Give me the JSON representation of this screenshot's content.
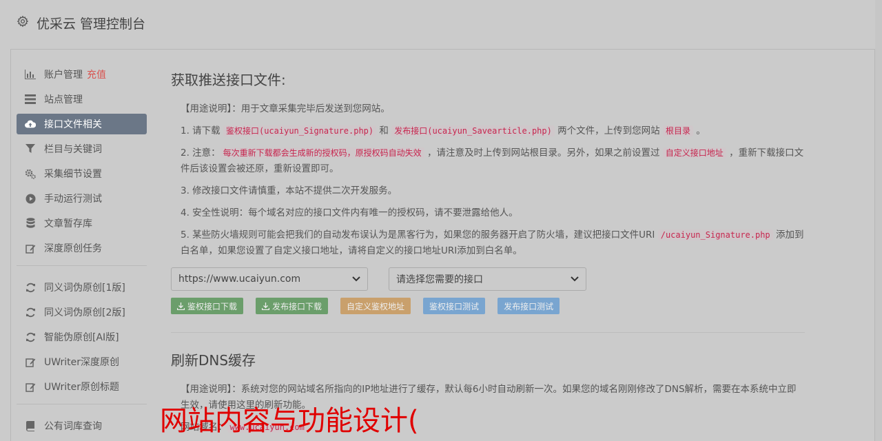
{
  "header": {
    "title": "优采云 管理控制台",
    "icon": "gear-icon"
  },
  "sidebar": {
    "items": [
      {
        "label": "账户管理",
        "extra": "充值",
        "icon": "bar-chart-icon"
      },
      {
        "label": "站点管理",
        "icon": "server-icon"
      },
      {
        "label": "接口文件相关",
        "icon": "cloud-upload-icon",
        "active": true
      },
      {
        "label": "栏目与关键词",
        "icon": "filter-icon"
      },
      {
        "label": "采集细节设置",
        "icon": "cogs-icon"
      },
      {
        "label": "手动运行测试",
        "icon": "play-circle-icon"
      },
      {
        "label": "文章暂存库",
        "icon": "database-icon"
      },
      {
        "label": "深度原创任务",
        "icon": "edit-icon"
      }
    ],
    "items2": [
      {
        "label": "同义词伪原创[1版]",
        "icon": "refresh-icon"
      },
      {
        "label": "同义词伪原创[2版]",
        "icon": "refresh-icon"
      },
      {
        "label": "智能伪原创[AI版]",
        "icon": "refresh-icon"
      },
      {
        "label": "UWriter深度原创",
        "icon": "edit-icon"
      },
      {
        "label": "UWriter原创标题",
        "icon": "edit-icon"
      }
    ],
    "items3": [
      {
        "label": "公有词库查询",
        "icon": "book-icon"
      }
    ]
  },
  "section1": {
    "title": "获取推送接口文件:",
    "usage": "【用途说明】：用于文章采集完毕后发送到您网站。",
    "p1": {
      "pre": "1. 请下载 ",
      "code1": "鉴权接口(ucaiyun_Signature.php)",
      "mid1": " 和 ",
      "code2": "发布接口(ucaiyun_Savearticle.php)",
      "mid2": " 两个文件，上传到您网站 ",
      "code3": "根目录",
      "post": " 。"
    },
    "p2": {
      "pre": "2. 注意：",
      "code1": "每次重新下载都会生成新的授权码，原授权码自动失效",
      "mid1": " ，请注意及时上传到网站根目录。另外，如果之前设置过 ",
      "code2": "自定义接口地址",
      "post": " ，重新下载接口文件后该设置会被还原，重新设置即可。"
    },
    "p3": "3. 修改接口文件请慎重，本站不提供二次开发服务。",
    "p4": "4. 安全性说明：每个域名对应的接口文件内有唯一的授权码，请不要泄露给他人。",
    "p5": {
      "pre": "5. 某些防火墙规则可能会把我们的自动发布误认为是黑客行为，如果您的服务器开启了防火墙，建议把接口文件URI ",
      "code1": "/ucaiyun_Signature.php",
      "post": " 添加到白名单，如果您设置了自定义接口地址，请将自定义的接口地址URI添加到白名单。"
    },
    "select_site": "https://www.ucaiyun.com",
    "select_api": "请选择您需要的接口",
    "buttons": {
      "auth_download": "鉴权接口下载",
      "publish_download": "发布接口下载",
      "custom_auth": "自定义鉴权地址",
      "auth_test": "鉴权接口测试",
      "publish_test": "发布接口测试"
    }
  },
  "section2": {
    "title": "刷新DNS缓存",
    "usage": "【用途说明】：系统对您的网站域名所指向的IP地址进行了缓存，默认每6小时自动刷新一次。如果您的域名刚刚修改了DNS解析，需要在本系统中立即生效，请使用这里的刷新功能。",
    "domain_label": "网站域名：",
    "domain_value": "www.ucaiyun.com"
  },
  "watermark": "网站内容与功能设计("
}
